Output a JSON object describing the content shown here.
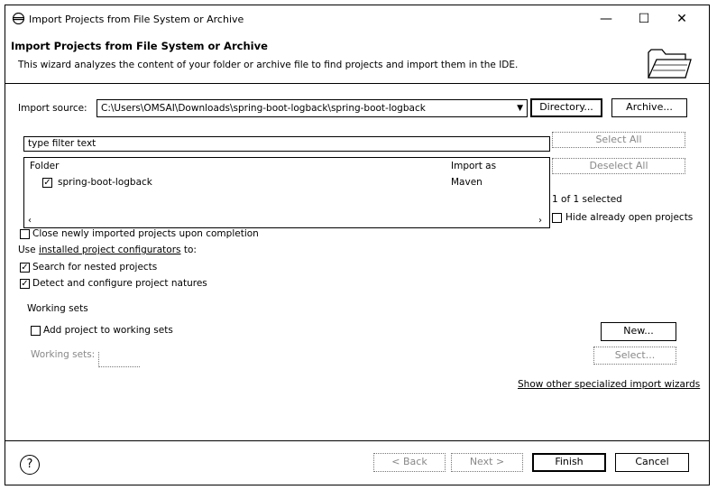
{
  "window": {
    "title": "Import Projects from File System or Archive",
    "controls": {
      "minimize": "—",
      "maximize": "☐",
      "close": "✕"
    }
  },
  "header": {
    "title": "Import Projects from File System or Archive",
    "description": "This wizard analyzes the content of your folder or archive file to find projects and import them in the IDE.",
    "icon": "folder-icon"
  },
  "import_source": {
    "label": "Import source:",
    "value": "C:\\Users\\OMSAI\\Downloads\\spring-boot-logback\\spring-boot-logback",
    "directory_button": "Directory...",
    "archive_button": "Archive..."
  },
  "filter": {
    "value": "type filter text"
  },
  "table": {
    "columns": [
      "Folder",
      "Import as"
    ],
    "rows": [
      {
        "checked": true,
        "folder": "spring-boot-logback",
        "import_as": "Maven"
      }
    ]
  },
  "side": {
    "select_all": "Select All",
    "deselect_all": "Deselect All",
    "selection_count": "1 of 1 selected",
    "hide_open_label": "Hide already open projects"
  },
  "options": {
    "close_newly_imported": {
      "label": "Close newly imported projects upon completion",
      "checked": false
    },
    "configurators_prefix": "Use ",
    "configurators_link": "installed project configurators",
    "configurators_suffix": " to:",
    "search_nested": {
      "label": "Search for nested projects",
      "checked": true
    },
    "detect_natures": {
      "label": "Detect and configure project natures",
      "checked": true
    }
  },
  "working_sets": {
    "group_label": "Working sets",
    "add_label": "Add project to working sets",
    "add_checked": false,
    "sets_label": "Working sets:",
    "new_button": "New...",
    "select_button": "Select..."
  },
  "other_wizards_link": "Show other specialized import wizards",
  "footer": {
    "help": "?",
    "back": "< Back",
    "next": "Next >",
    "finish": "Finish",
    "cancel": "Cancel"
  }
}
